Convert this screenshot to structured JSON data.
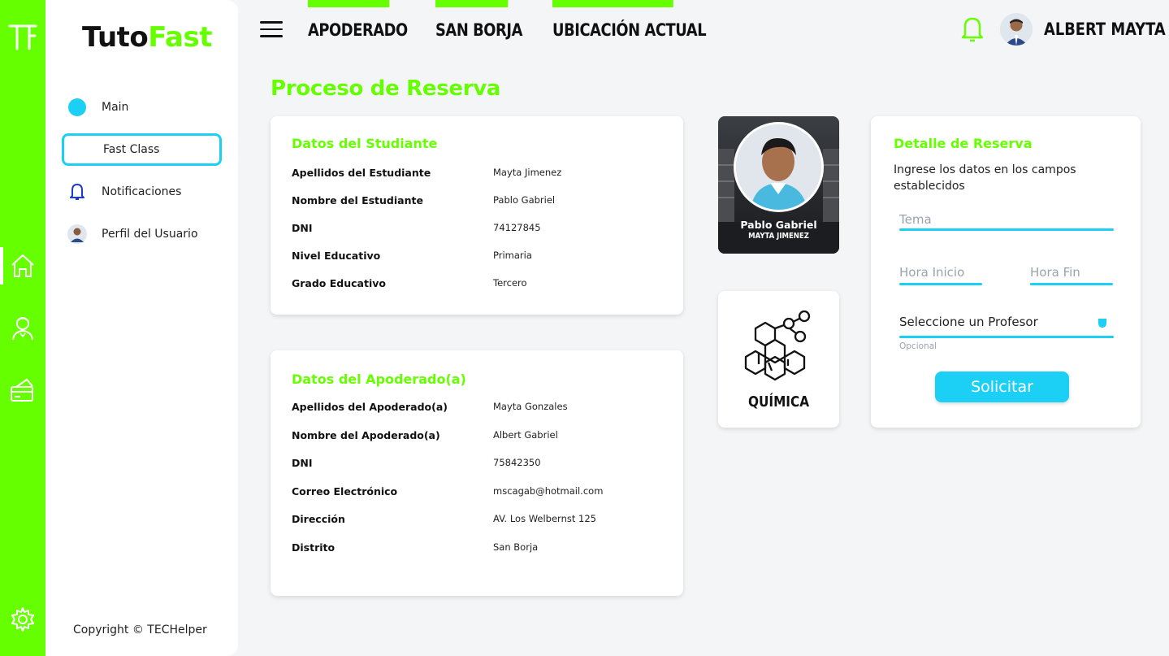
{
  "brand": {
    "part1": "Tuto",
    "part2": "Fast"
  },
  "rail": {
    "icons": [
      "logo-icon",
      "home-icon",
      "tutor-icon",
      "payment-icon",
      "settings-icon"
    ]
  },
  "sidebar": {
    "items": [
      {
        "label": "Main",
        "icon": "dot-icon"
      },
      {
        "label": "Fast Class",
        "icon": ""
      },
      {
        "label": "Notificaciones",
        "icon": "bell-icon"
      },
      {
        "label": "Perfil del Usuario",
        "icon": "user-avatar-icon"
      }
    ],
    "copyright": "Copyright © TECHelper"
  },
  "topbar": {
    "tabs": [
      "APODERADO",
      "SAN BORJA",
      "UBICACIÓN ACTUAL"
    ],
    "user_name": "ALBERT MAYTA"
  },
  "page_title": "Proceso de Reserva",
  "student": {
    "title": "Datos del Studiante",
    "rows": [
      {
        "k": "Apellidos del Estudiante",
        "v": "Mayta Jimenez"
      },
      {
        "k": "Nombre del Estudiante",
        "v": "Pablo Gabriel"
      },
      {
        "k": "DNI",
        "v": "74127845"
      },
      {
        "k": "Nivel Educativo",
        "v": "Primaria"
      },
      {
        "k": "Grado Educativo",
        "v": "Tercero"
      }
    ]
  },
  "guardian": {
    "title": "Datos del Apoderado(a)",
    "rows": [
      {
        "k": "Apellidos del Apoderado(a)",
        "v": "Mayta Gonzales"
      },
      {
        "k": "Nombre del Apoderado(a)",
        "v": "Albert Gabriel"
      },
      {
        "k": "DNI",
        "v": "75842350"
      },
      {
        "k": "Correo Electrónico",
        "v": "mscagab@hotmail.com"
      },
      {
        "k": "Dirección",
        "v": "AV. Los Welbernst 125"
      },
      {
        "k": "Distrito",
        "v": "San Borja"
      }
    ]
  },
  "profile_card": {
    "name": "Pablo Gabriel",
    "surname": "MAYTA JIMENEZ"
  },
  "subject": {
    "label": "QUÍMICA",
    "icon": "chemistry-molecule-icon"
  },
  "detail": {
    "title": "Detalle de Reserva",
    "subtitle": "Ingrese los datos en los campos establecidos",
    "tema_placeholder": "Tema",
    "hora_inicio_placeholder": "Hora Inicio",
    "hora_fin_placeholder": "Hora Fin",
    "profesor_select": "Seleccione un Profesor",
    "profesor_hint": "Opcional",
    "submit_label": "Solicitar"
  },
  "colors": {
    "accent": "#66ff00",
    "secondary": "#1ccff5",
    "background": "#f4f5f7"
  }
}
